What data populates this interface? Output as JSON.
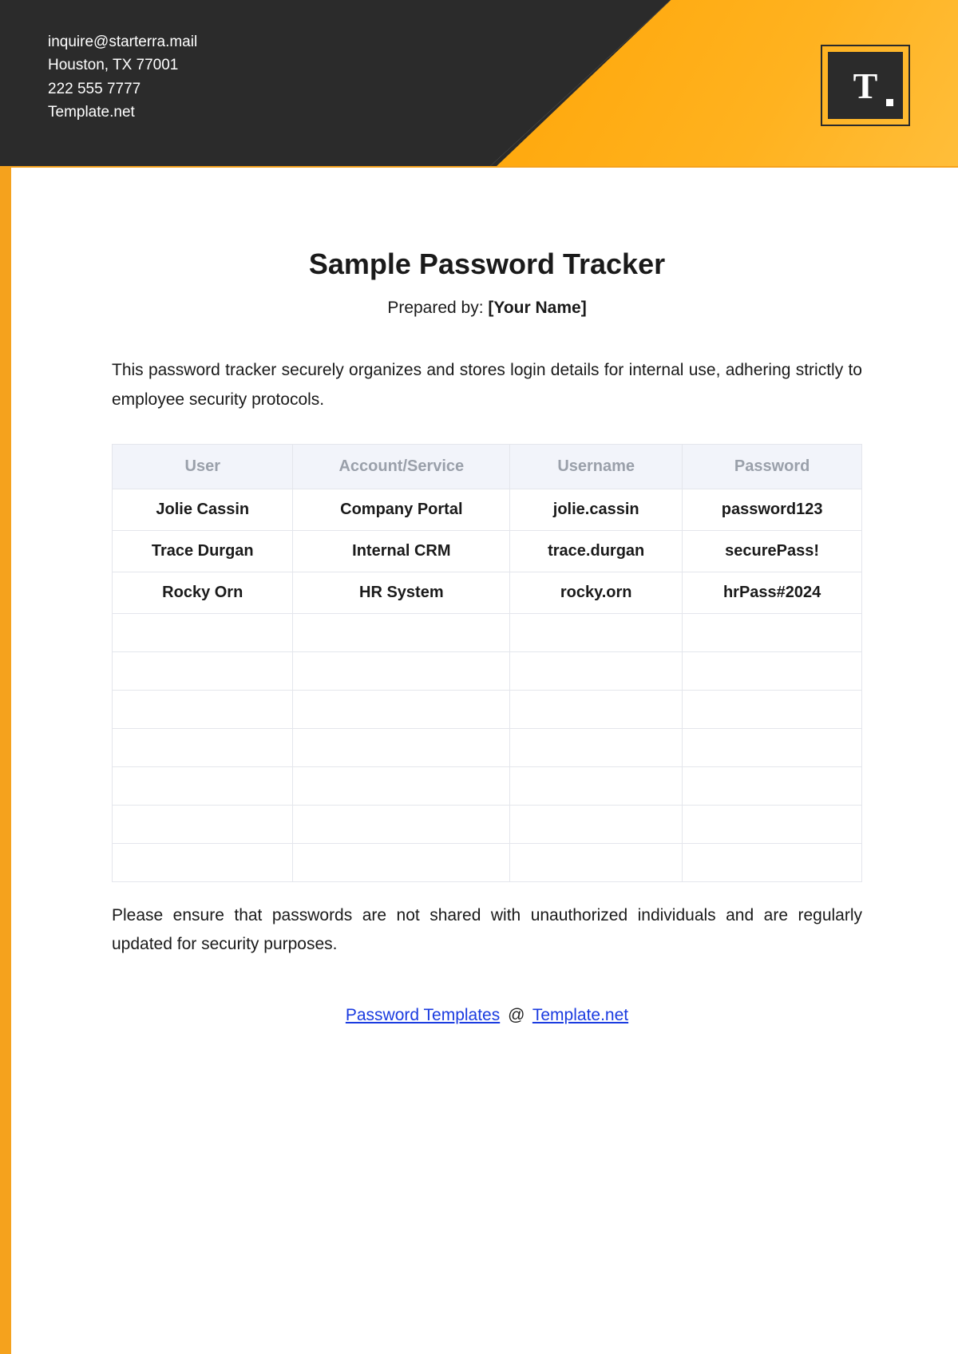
{
  "header": {
    "contact": {
      "email": "inquire@starterra.mail",
      "address": "Houston, TX 77001",
      "phone": "222 555 7777",
      "site": "Template.net"
    },
    "logo_letter": "T"
  },
  "doc": {
    "title": "Sample Password Tracker",
    "prepared_label": "Prepared by: ",
    "prepared_value": "[Your Name]",
    "intro": "This password tracker securely organizes and stores login details for internal use, adhering strictly to employee security protocols.",
    "outro": "Please ensure that passwords are not shared with unauthorized individuals and are regularly updated for security purposes."
  },
  "table": {
    "headers": [
      "User",
      "Account/Service",
      "Username",
      "Password"
    ],
    "rows": [
      [
        "Jolie Cassin",
        "Company Portal",
        "jolie.cassin",
        "password123"
      ],
      [
        "Trace Durgan",
        "Internal CRM",
        "trace.durgan",
        "securePass!"
      ],
      [
        "Rocky Orn",
        "HR System",
        "rocky.orn",
        "hrPass#2024"
      ],
      [
        "",
        "",
        "",
        ""
      ],
      [
        "",
        "",
        "",
        ""
      ],
      [
        "",
        "",
        "",
        ""
      ],
      [
        "",
        "",
        "",
        ""
      ],
      [
        "",
        "",
        "",
        ""
      ],
      [
        "",
        "",
        "",
        ""
      ],
      [
        "",
        "",
        "",
        ""
      ]
    ]
  },
  "footer": {
    "link1_text": "Password Templates",
    "separator": "@",
    "link2_text": "Template.net"
  }
}
